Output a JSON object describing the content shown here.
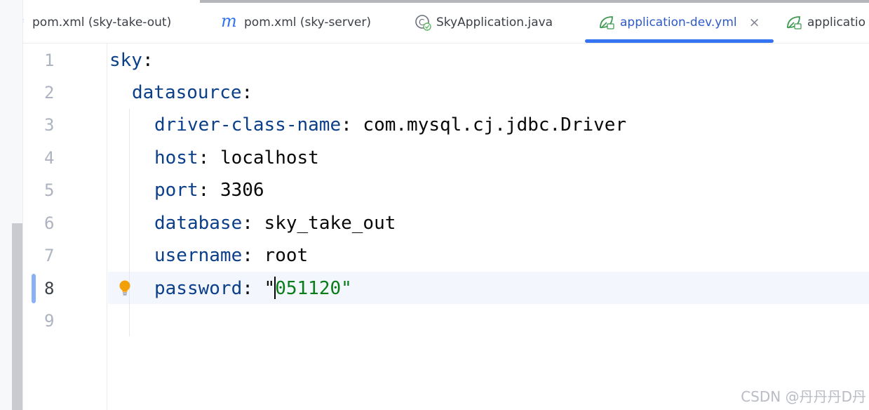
{
  "tabs": [
    {
      "label": "pom.xml (sky-take-out)",
      "icon": "maven-icon",
      "active": false
    },
    {
      "label": "pom.xml (sky-server)",
      "icon": "maven-icon",
      "active": false
    },
    {
      "label": "SkyApplication.java",
      "icon": "spring-class-icon",
      "active": false
    },
    {
      "label": "application-dev.yml",
      "icon": "spring-yaml-icon",
      "active": true
    },
    {
      "label": "applicatio",
      "icon": "spring-yaml-icon",
      "active": false
    }
  ],
  "line_numbers": [
    "1",
    "2",
    "3",
    "4",
    "5",
    "6",
    "7",
    "8",
    "9"
  ],
  "current_line": "8",
  "code": {
    "l1": {
      "key": "sky",
      "colon": ":"
    },
    "l2": {
      "key": "datasource",
      "colon": ":"
    },
    "l3": {
      "key": "driver-class-name",
      "colon": ": ",
      "value": "com.mysql.cj.jdbc.Driver"
    },
    "l4": {
      "key": "host",
      "colon": ": ",
      "value": "localhost"
    },
    "l5": {
      "key": "port",
      "colon": ": ",
      "value": "3306"
    },
    "l6": {
      "key": "database",
      "colon": ": ",
      "value": "sky_take_out"
    },
    "l7": {
      "key": "username",
      "colon": ": ",
      "value": "root"
    },
    "l8": {
      "key": "password",
      "colon": ": ",
      "quote_open": "\"",
      "value": "051120",
      "quote_close": "\""
    }
  },
  "watermark": "CSDN @丹丹丹D丹",
  "colors": {
    "accent": "#3574f0",
    "yaml_key": "#0b3f8a",
    "string": "#067d17",
    "current_line_bg": "#f3f6fd"
  }
}
